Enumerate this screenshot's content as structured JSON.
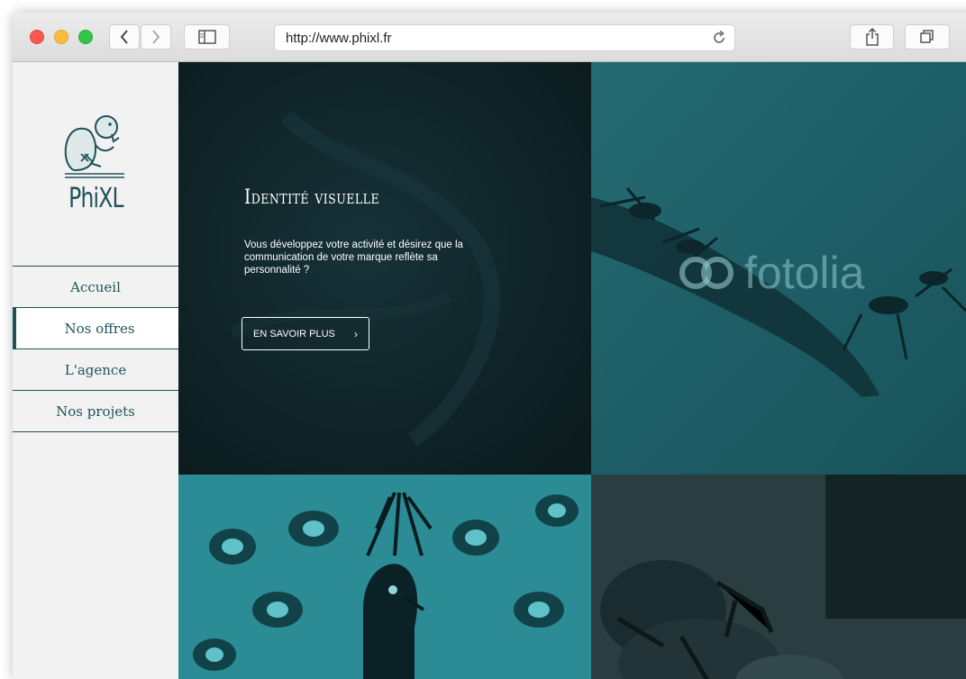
{
  "browser": {
    "url": "http://www.phixl.fr"
  },
  "logo": {
    "text": "PhiXL"
  },
  "nav": {
    "items": [
      {
        "label": "Accueil"
      },
      {
        "label": "Nos offres"
      },
      {
        "label": "L'agence"
      },
      {
        "label": "Nos projets"
      }
    ]
  },
  "hero": {
    "title": "Identité visuelle",
    "text": "Vous développez votre activité et désirez que la communication de votre marque reflète sa personnalité ?",
    "button": "EN SAVOIR PLUS",
    "button_icon": "chevron-right-icon"
  },
  "watermark": {
    "text": "fotolia"
  },
  "colors": {
    "brand": "#1f525a",
    "hero_bg": "#0e2226",
    "teal": "#1e5f67"
  }
}
